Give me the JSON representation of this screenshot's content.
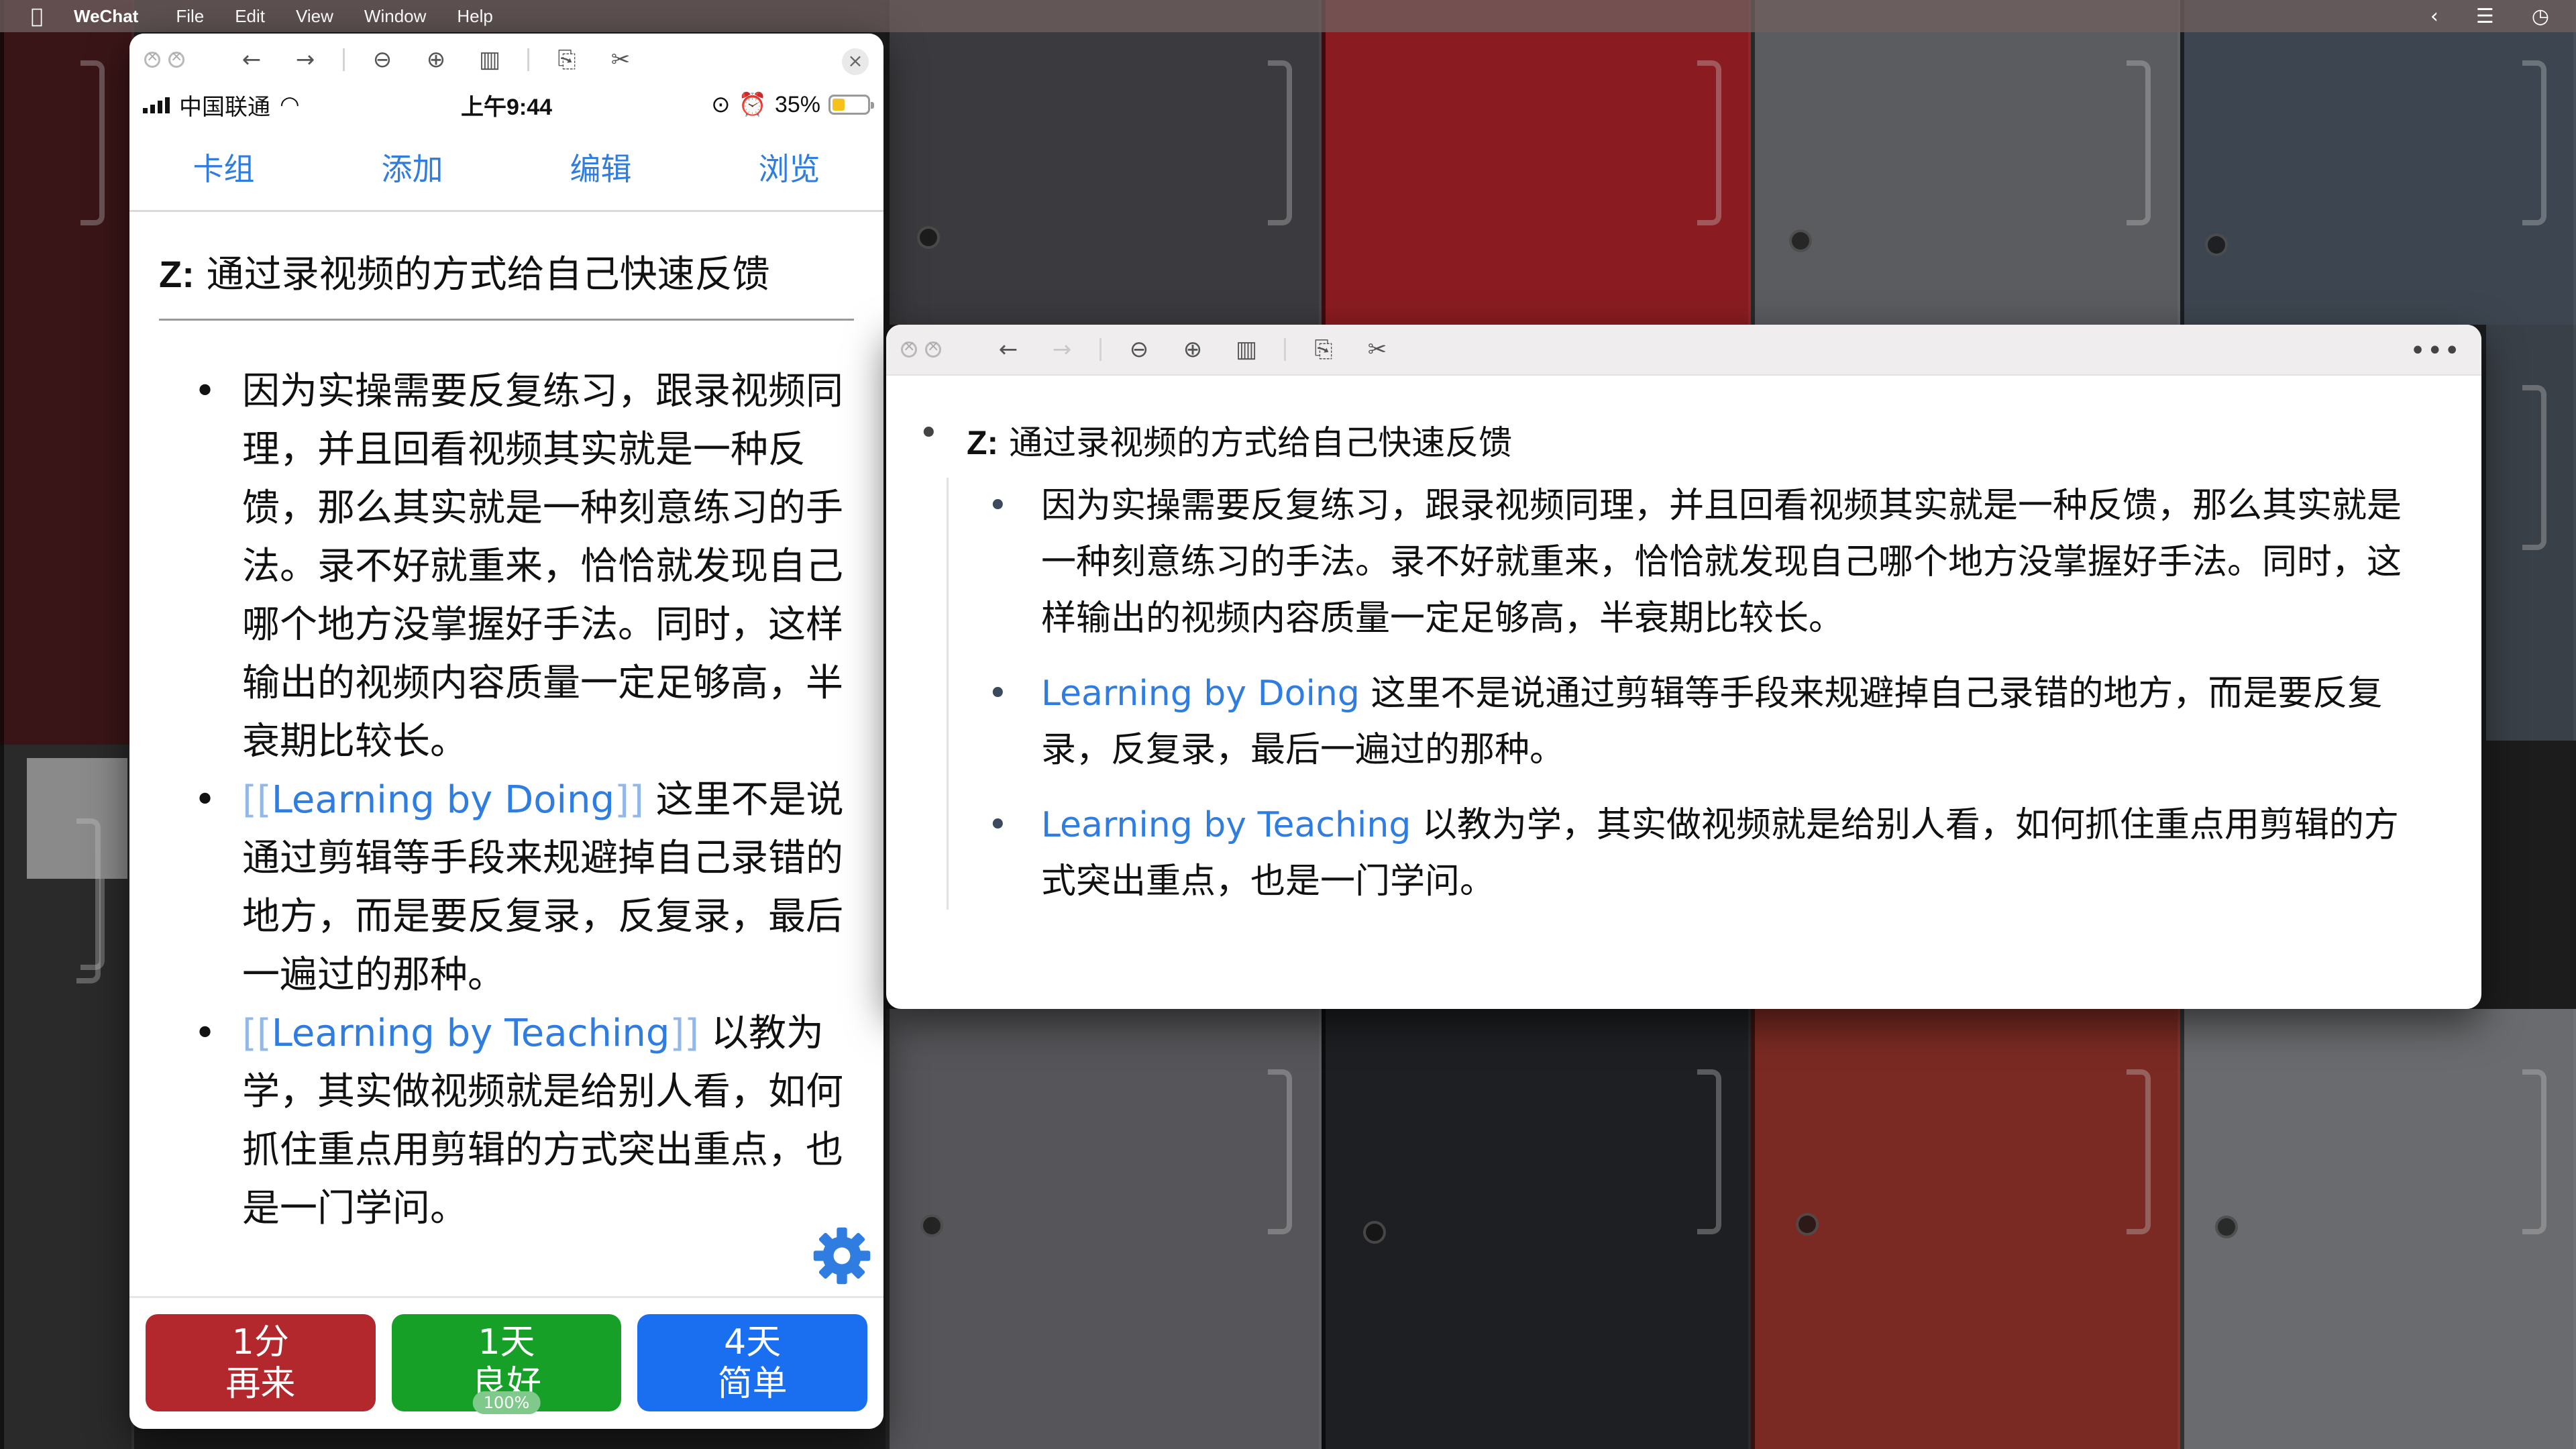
{
  "menubar": {
    "app_name": "WeChat",
    "menus": [
      "File",
      "Edit",
      "View",
      "Window",
      "Help"
    ]
  },
  "phone_window": {
    "toolbar_icons": [
      "back-arrow-icon",
      "forward-arrow-icon",
      "zoom-out-icon",
      "zoom-in-icon",
      "fit-screen-icon",
      "rotate-icon",
      "tools-icon",
      "close-icon"
    ],
    "status": {
      "carrier": "中国联通",
      "time": "上午9:44",
      "battery_text": "35%",
      "battery_level": 0.35
    },
    "nav": [
      "卡组",
      "添加",
      "编辑",
      "浏览"
    ],
    "card": {
      "title_prefix": "Z:",
      "title_text": "通过录视频的方式给自己快速反馈",
      "bullets": [
        {
          "text": "因为实操需要反复练习，跟录视频同理，并且回看视频其实就是一种反馈，那么其实就是一种刻意练习的手法。录不好就重来，恰恰就发现自己哪个地方没掌握好手法。同时，这样输出的视频内容质量一定足够高，半衰期比较长。"
        },
        {
          "link_open": "[[",
          "link": "Learning by Doing",
          "link_close": "]]",
          "text": " 这里不是说通过剪辑等手段来规避掉自己录错的地方，而是要反复录，反复录，最后一遍过的那种。"
        },
        {
          "link_open": "[[",
          "link": "Learning by Teaching",
          "link_close": "]]",
          "text": " 以教为学，其实做视频就是给别人看，如何抓住重点用剪辑的方式突出重点，也是一门学问。"
        }
      ]
    },
    "answers": [
      {
        "interval": "1分",
        "label": "再来"
      },
      {
        "interval": "1天",
        "label": "良好",
        "badge": "100%"
      },
      {
        "interval": "4天",
        "label": "简单"
      }
    ]
  },
  "preview_window": {
    "title_prefix": "Z:",
    "title_text": "通过录视频的方式给自己快速反馈",
    "bullets": [
      {
        "text": "因为实操需要反复练习，跟录视频同理，并且回看视频其实就是一种反馈，那么其实就是一种刻意练习的手法。录不好就重来，恰恰就发现自己哪个地方没掌握好手法。同时，这样输出的视频内容质量一定足够高，半衰期比较长。"
      },
      {
        "link": "Learning by Doing",
        "text": " 这里不是说通过剪辑等手段来规避掉自己录错的地方，而是要反复录，反复录，最后一遍过的那种。"
      },
      {
        "link": "Learning by Teaching",
        "text": " 以教为学，其实做视频就是给别人看，如何抓住重点用剪辑的方式突出重点，也是一门学问。"
      }
    ]
  },
  "colors": {
    "link": "#2f7de1",
    "again": "#b3282d",
    "good": "#16a028",
    "easy": "#1a6ff0"
  }
}
